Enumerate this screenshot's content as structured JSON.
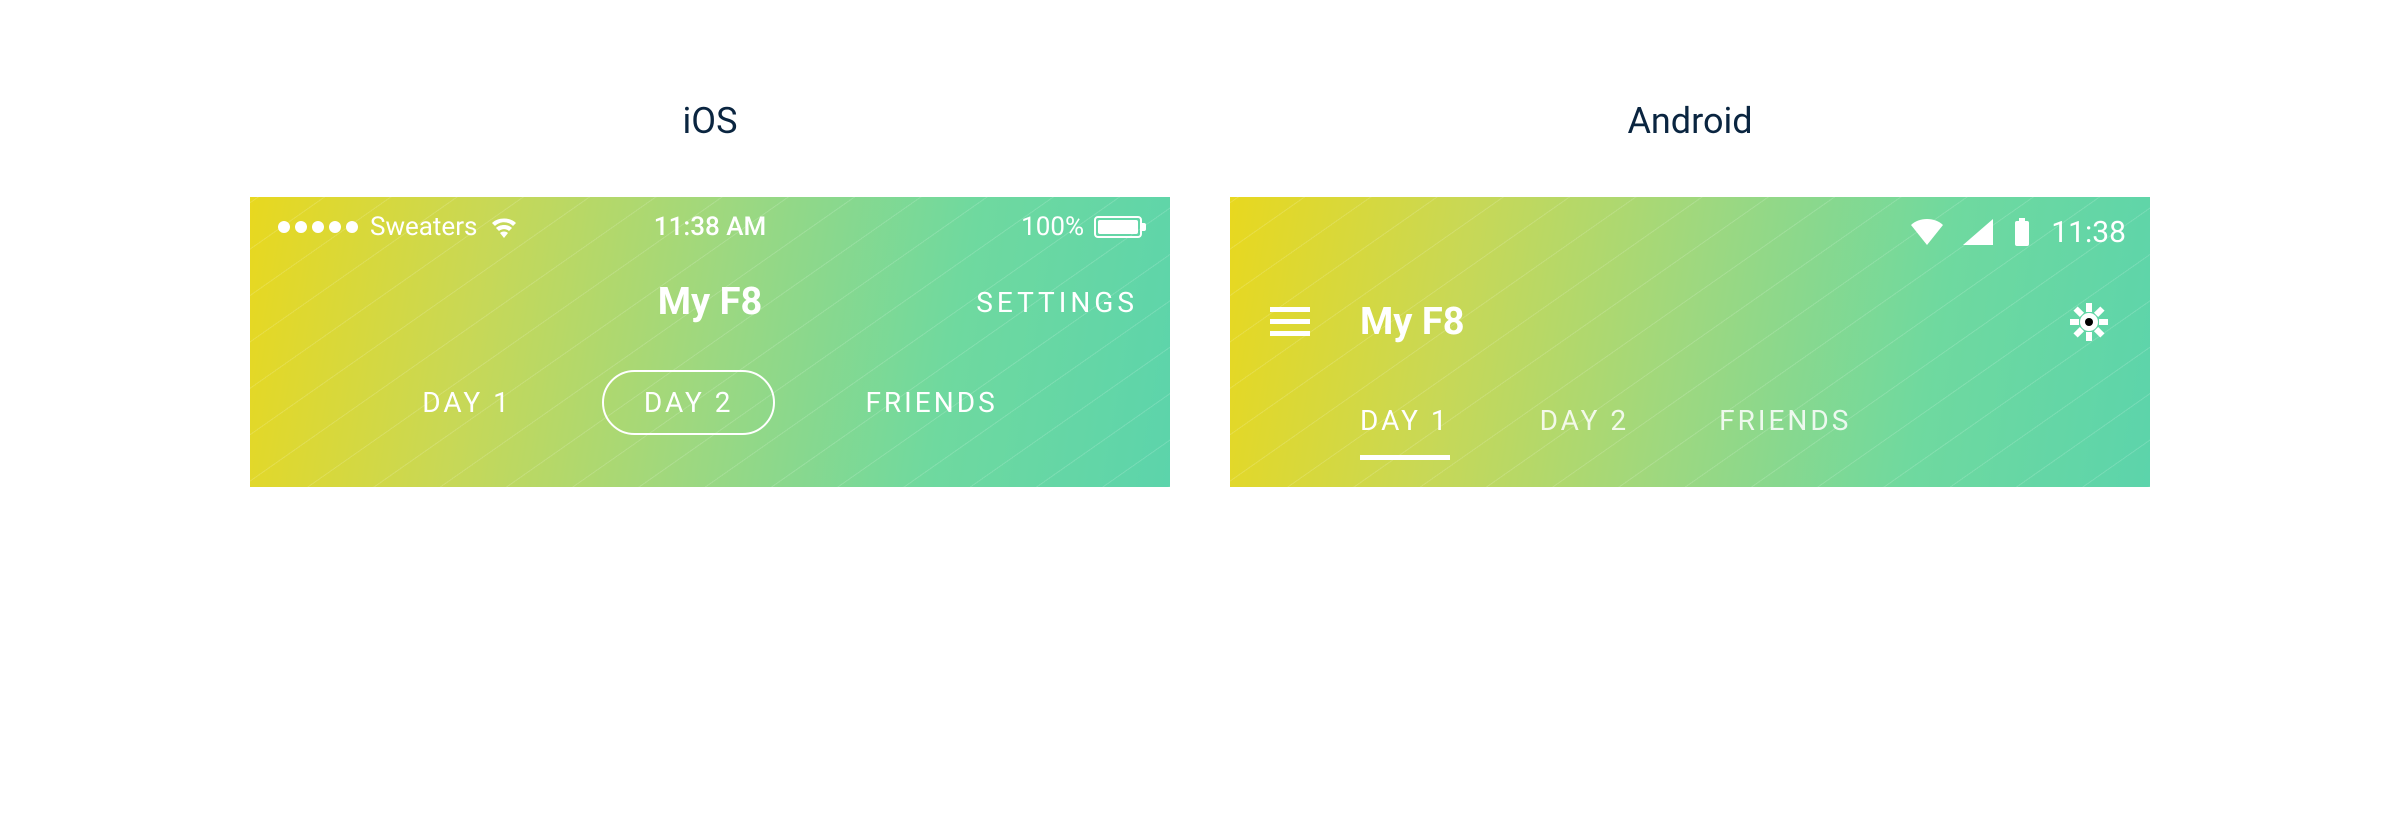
{
  "platforms": {
    "ios": {
      "label": "iOS",
      "statusbar": {
        "carrier": "Sweaters",
        "time": "11:38 AM",
        "battery": "100%"
      },
      "navbar": {
        "title": "My F8",
        "settings": "SETTINGS"
      },
      "tabs": [
        "DAY 1",
        "DAY 2",
        "FRIENDS"
      ],
      "active_tab": 1
    },
    "android": {
      "label": "Android",
      "statusbar": {
        "time": "11:38"
      },
      "navbar": {
        "title": "My F8"
      },
      "tabs": [
        "DAY 1",
        "DAY 2",
        "FRIENDS"
      ],
      "active_tab": 0
    }
  }
}
